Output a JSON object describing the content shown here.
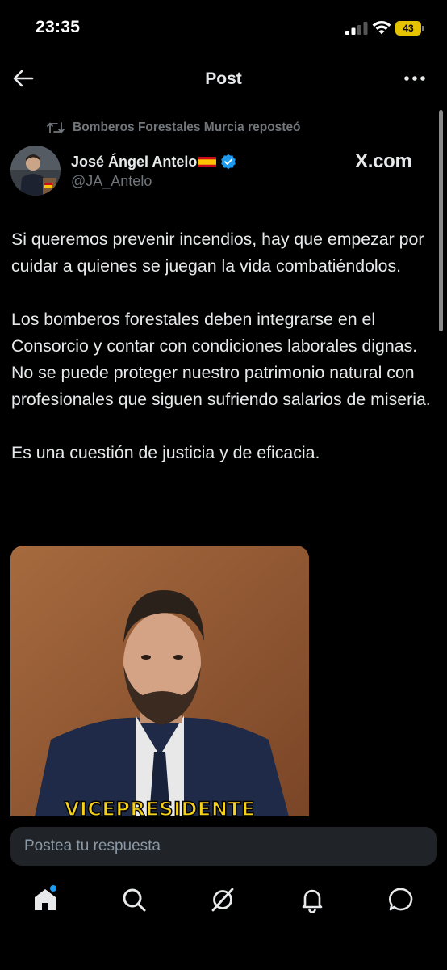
{
  "status_bar": {
    "time": "23:35",
    "battery": "43",
    "battery_color": "#e5c300"
  },
  "header": {
    "title": "Post",
    "back_icon": "arrow-left-icon",
    "more_icon": "more-horizontal-icon"
  },
  "post": {
    "repost_label": "Bomberos Forestales Murcia reposteó",
    "author_name": "José Ángel Antelo",
    "author_handle": "@JA_Antelo",
    "verified": true,
    "verified_color": "#1d9bf0",
    "watermark": "X.com",
    "paragraphs": [
      "Si queremos prevenir incendios, hay que empezar por cuidar a quienes se juegan la vida combatiéndolos.",
      "Los bomberos forestales deben integrarse en el Consorcio y contar con condiciones laborales dignas. No se puede proteger nuestro patrimonio natural con profesionales que siguen sufriendo salarios de miseria.",
      "Es una cuestión de justicia y de eficacia."
    ],
    "media_caption": "VICEPRESIDENTE"
  },
  "reply": {
    "placeholder": "Postea tu respuesta"
  },
  "bottom_nav": {
    "items": [
      "home-icon",
      "search-icon",
      "grok-icon",
      "notifications-icon",
      "messages-icon"
    ],
    "active": "home-icon",
    "accent": "#1d9bf0"
  }
}
